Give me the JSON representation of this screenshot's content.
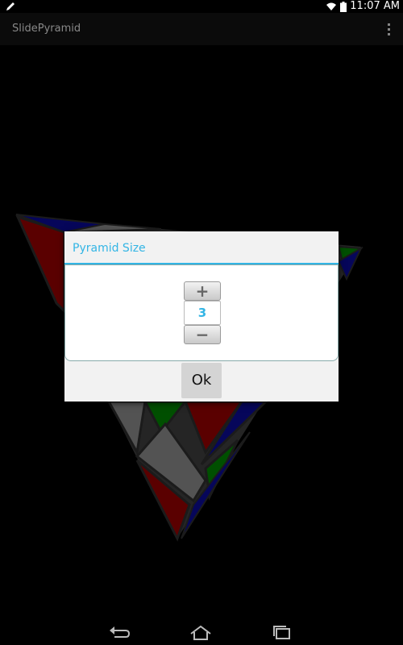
{
  "status_bar": {
    "time": "11:07 AM",
    "icons": [
      "pencil-icon",
      "wifi-icon",
      "battery-icon"
    ]
  },
  "action_bar": {
    "title": "SlidePyramid",
    "overflow_icon": "overflow-menu-icon"
  },
  "dialog": {
    "title": "Pyramid Size",
    "picker": {
      "increment_label": "+",
      "value": "3",
      "decrement_label": "−"
    },
    "ok_label": "Ok"
  },
  "nav_bar": {
    "icons": [
      "back-icon",
      "home-icon",
      "recent-apps-icon"
    ]
  },
  "colors": {
    "accent": "#33b5e5",
    "red": "#8b0000",
    "green": "#007a00",
    "blue": "#0a0a8a",
    "gray": "#808080"
  }
}
